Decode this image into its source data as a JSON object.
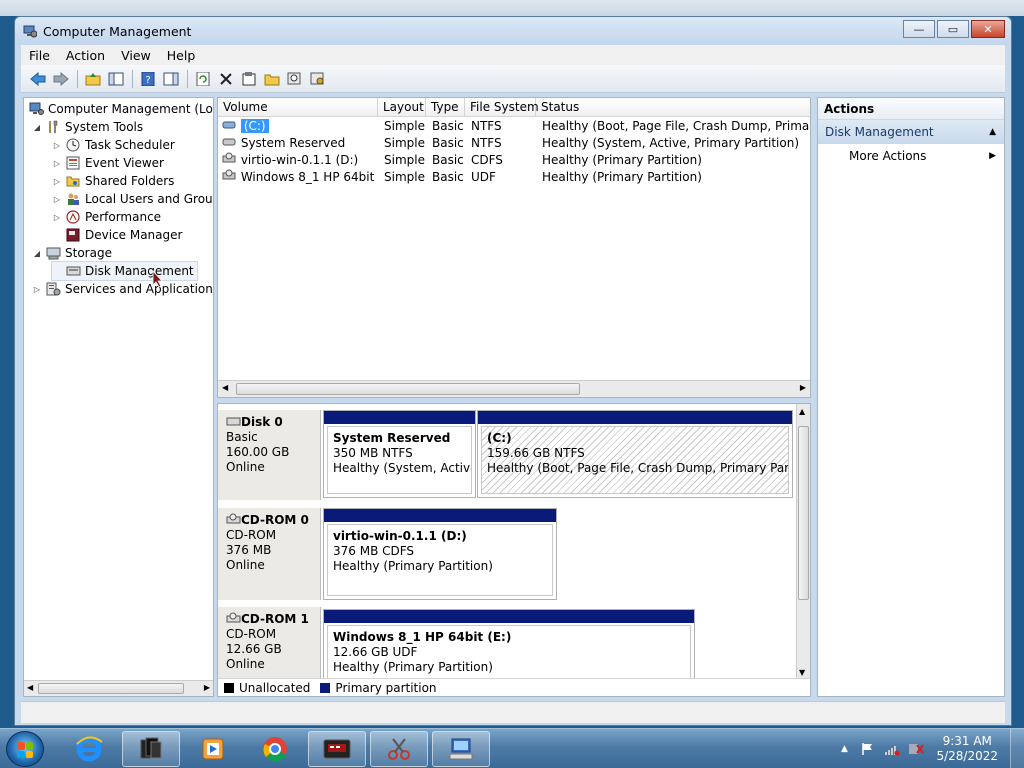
{
  "window": {
    "title": "Computer Management",
    "min_label": "—",
    "max_label": "▭",
    "close_label": "✕"
  },
  "menu": [
    "File",
    "Action",
    "View",
    "Help"
  ],
  "tree": {
    "root": "Computer Management (Local",
    "system_tools": "System Tools",
    "task_scheduler": "Task Scheduler",
    "event_viewer": "Event Viewer",
    "shared_folders": "Shared Folders",
    "local_users": "Local Users and Groups",
    "performance": "Performance",
    "device_manager": "Device Manager",
    "storage": "Storage",
    "disk_management": "Disk Management",
    "services": "Services and Applications"
  },
  "volume_list": {
    "columns": [
      "Volume",
      "Layout",
      "Type",
      "File System",
      "Status"
    ],
    "rows": [
      {
        "volume": "(C:)",
        "layout": "Simple",
        "type": "Basic",
        "fs": "NTFS",
        "status": "Healthy (Boot, Page File, Crash Dump, Primary Part"
      },
      {
        "volume": "System Reserved",
        "layout": "Simple",
        "type": "Basic",
        "fs": "NTFS",
        "status": "Healthy (System, Active, Primary Partition)"
      },
      {
        "volume": "virtio-win-0.1.1 (D:)",
        "layout": "Simple",
        "type": "Basic",
        "fs": "CDFS",
        "status": "Healthy (Primary Partition)"
      },
      {
        "volume": "Windows 8_1 HP 64bit (E:)",
        "layout": "Simple",
        "type": "Basic",
        "fs": "UDF",
        "status": "Healthy (Primary Partition)"
      }
    ]
  },
  "disks": {
    "disk0": {
      "name": "Disk 0",
      "kind": "Basic",
      "size": "160.00 GB",
      "state": "Online",
      "p1": {
        "name": "System Reserved",
        "size": "350 MB NTFS",
        "status": "Healthy (System, Active, P"
      },
      "p2": {
        "name": "(C:)",
        "size": "159.66 GB NTFS",
        "status": "Healthy (Boot, Page File, Crash Dump, Primary Partition)"
      }
    },
    "cdrom0": {
      "name": "CD-ROM 0",
      "kind": "CD-ROM",
      "size": "376 MB",
      "state": "Online",
      "p1": {
        "name": "virtio-win-0.1.1  (D:)",
        "size": "376 MB CDFS",
        "status": "Healthy (Primary Partition)"
      }
    },
    "cdrom1": {
      "name": "CD-ROM 1",
      "kind": "CD-ROM",
      "size": "12.66 GB",
      "state": "Online",
      "p1": {
        "name": "Windows 8_1 HP 64bit  (E:)",
        "size": "12.66 GB UDF",
        "status": "Healthy (Primary Partition)"
      }
    }
  },
  "legend": {
    "unallocated": "Unallocated",
    "primary": "Primary partition",
    "unallocated_color": "#000000",
    "primary_color": "#0a1a78"
  },
  "actions": {
    "title": "Actions",
    "section": "Disk Management",
    "more": "More Actions"
  },
  "taskbar": {
    "time": "9:31 AM",
    "date": "5/28/2022"
  },
  "icons": {
    "back": "back-arrow-icon",
    "forward": "forward-arrow-icon",
    "up": "up-folder-icon",
    "show_hide": "show-hide-tree-icon",
    "help": "help-icon",
    "refresh": "refresh-icon",
    "delete": "delete-icon",
    "properties": "properties-icon",
    "open": "open-folder-icon",
    "search": "search-icon",
    "settings": "settings-icon"
  }
}
